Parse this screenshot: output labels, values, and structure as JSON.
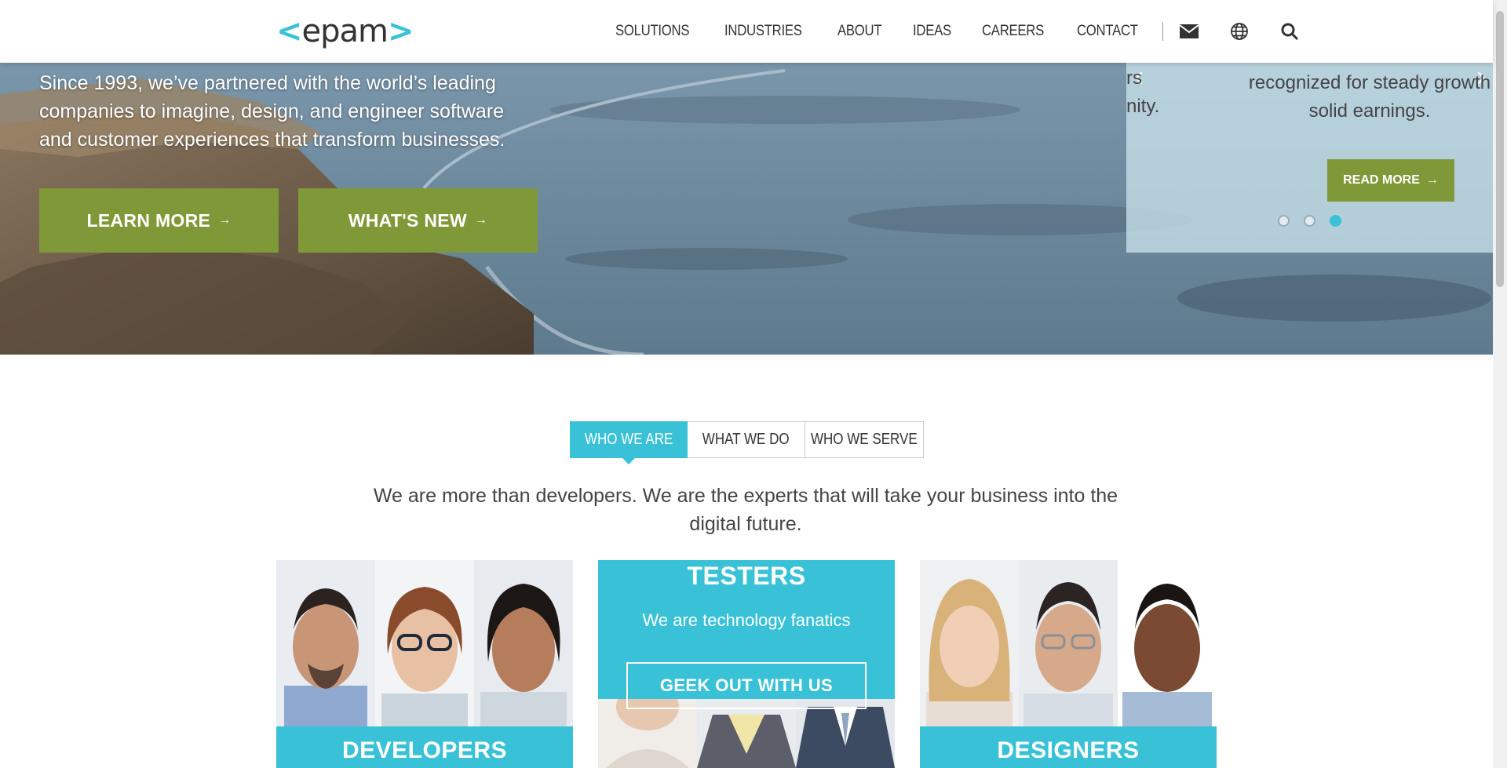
{
  "header": {
    "logo": {
      "left_bracket": "<",
      "text": "epam",
      "right_bracket": ">"
    },
    "nav": [
      "SOLUTIONS",
      "INDUSTRIES",
      "ABOUT",
      "IDEAS",
      "CAREERS",
      "CONTACT"
    ],
    "icons": [
      "mail-icon",
      "globe-icon",
      "search-icon"
    ]
  },
  "hero": {
    "text": "Since 1993, we’ve partnered with the world’s leading companies to imagine, design, and engineer software and customer experiences that transform businesses.",
    "learn_more": "LEARN MORE",
    "whats_new": "WHAT'S NEW",
    "arrow": "→",
    "news": {
      "frag_1": "rs",
      "frag_2": "nity.",
      "line_1": "recognized for steady growth",
      "line_2": "solid earnings.",
      "read_more": "READ MORE",
      "active_slide": 3,
      "slide_count": 3
    }
  },
  "tabs": [
    "WHO WE ARE",
    "WHAT WE DO",
    "WHO WE SERVE"
  ],
  "intro": "We are more than developers. We are the experts that will take your business into the digital future.",
  "cards": {
    "developers": "DEVELOPERS",
    "testers_title": "TESTERS",
    "testers_sub": "We are technology fanatics",
    "testers_button": "GEEK OUT WITH US",
    "designers": "DESIGNERS"
  },
  "colors": {
    "accent": "#39c2d7",
    "green": "#7f9938"
  }
}
